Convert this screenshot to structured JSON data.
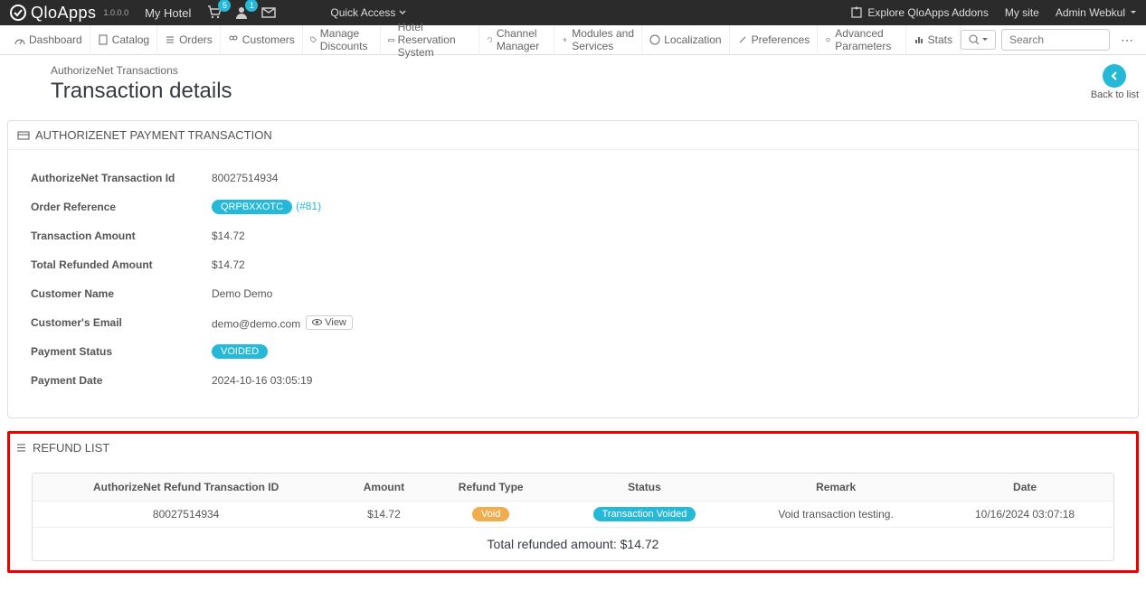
{
  "topbar": {
    "brand": "QloApps",
    "version": "1.0.0.0",
    "hotel": "My Hotel",
    "cart_badge": "5",
    "user_badge": "1",
    "quick_access": "Quick Access",
    "explore": "Explore QloApps Addons",
    "my_site": "My site",
    "admin_user": "Admin Webkul"
  },
  "nav": {
    "dashboard": "Dashboard",
    "catalog": "Catalog",
    "orders": "Orders",
    "customers": "Customers",
    "discounts": "Manage Discounts",
    "reservation": "Hotel Reservation System",
    "channel": "Channel Manager",
    "modules": "Modules and Services",
    "localization": "Localization",
    "preferences": "Preferences",
    "advanced": "Advanced Parameters",
    "stats": "Stats",
    "search_placeholder": "Search"
  },
  "breadcrumb": "AuthorizeNet Transactions",
  "page_title": "Transaction details",
  "back_label": "Back to list",
  "panel1": {
    "heading": "AUTHORIZENET PAYMENT TRANSACTION",
    "labels": {
      "txn_id": "AuthorizeNet Transaction Id",
      "order_ref": "Order Reference",
      "txn_amount": "Transaction Amount",
      "refunded": "Total Refunded Amount",
      "cust_name": "Customer Name",
      "cust_email": "Customer's Email",
      "pay_status": "Payment Status",
      "pay_date": "Payment Date"
    },
    "values": {
      "txn_id": "80027514934",
      "order_ref": "QRPBXXOTC",
      "order_ref_id": "(#81)",
      "txn_amount": "$14.72",
      "refunded": "$14.72",
      "cust_name": "Demo Demo",
      "cust_email": "demo@demo.com",
      "view_btn": "View",
      "pay_status": "VOIDED",
      "pay_date": "2024-10-16 03:05:19"
    }
  },
  "panel2": {
    "heading": "REFUND LIST",
    "headers": {
      "refund_id": "AuthorizeNet Refund Transaction ID",
      "amount": "Amount",
      "refund_type": "Refund Type",
      "status": "Status",
      "remark": "Remark",
      "date": "Date"
    },
    "row": {
      "refund_id": "80027514934",
      "amount": "$14.72",
      "refund_type": "Void",
      "status": "Transaction Voided",
      "remark": "Void transaction testing.",
      "date": "10/16/2024 03:07:18"
    },
    "total": "Total refunded amount: $14.72"
  }
}
